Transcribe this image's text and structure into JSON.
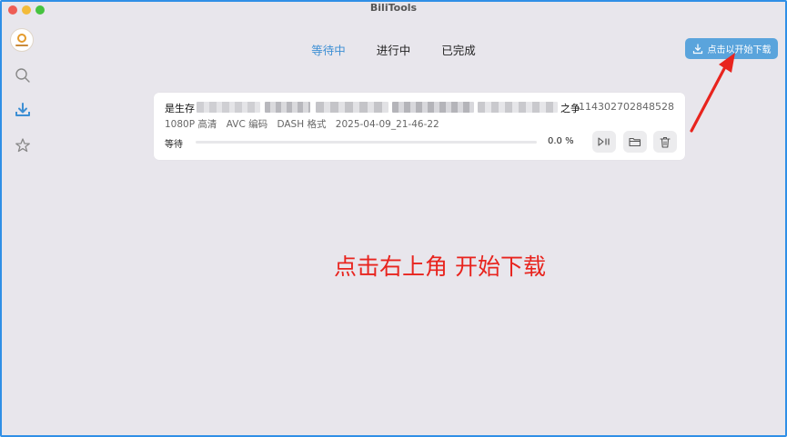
{
  "window": {
    "title": "BiliTools"
  },
  "tabs": [
    {
      "label": "等待中",
      "active": true
    },
    {
      "label": "进行中",
      "active": false
    },
    {
      "label": "已完成",
      "active": false
    }
  ],
  "start_button": {
    "label": "点击以开始下载"
  },
  "task": {
    "title_start": "是生存",
    "title_end": "之争",
    "id": "114302702848528",
    "meta": [
      "1080P 高清",
      "AVC 编码",
      "DASH 格式",
      "2025-04-09_21-46-22"
    ],
    "status": "等待",
    "progress": 0.0,
    "progress_text": "0.0 %"
  },
  "annotation": {
    "text": "点击右上角 开始下载",
    "color": "#e8241e"
  },
  "colors": {
    "accent": "#5aa4dc",
    "active_tab": "#3d8fd4",
    "window_bg": "#e8e6ec",
    "border": "#2f8fe6"
  },
  "icons": {
    "sidebar": [
      "logo",
      "search-icon",
      "download-icon",
      "star-icon"
    ],
    "actions": [
      "play-pause-icon",
      "folder-icon",
      "trash-icon"
    ]
  }
}
